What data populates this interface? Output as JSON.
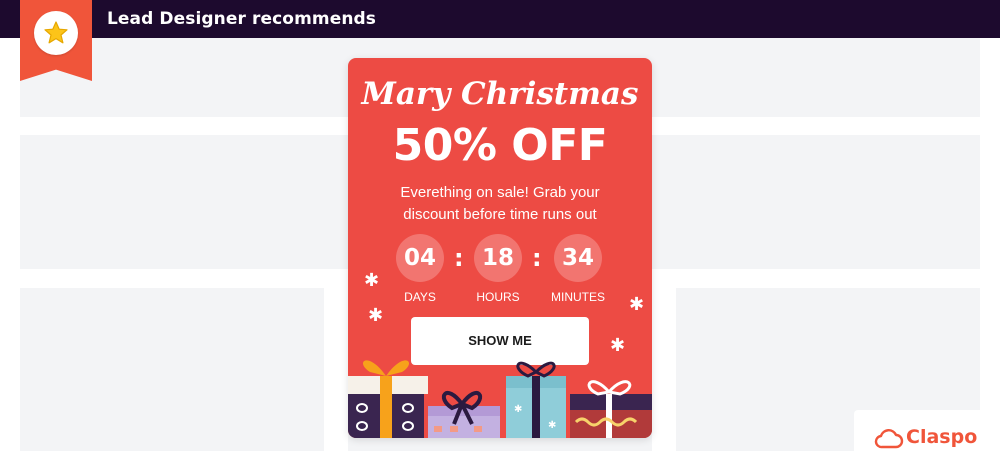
{
  "header": {
    "title": "Lead Designer recommends"
  },
  "badge": {
    "icon": "star-icon"
  },
  "popup": {
    "title": "Mary Christmas",
    "offer": "50% OFF",
    "description": "Everething on sale! Grab your discount before time runs out",
    "countdown": [
      {
        "value": "04",
        "label": "DAYS"
      },
      {
        "value": "18",
        "label": "HOURS"
      },
      {
        "value": "34",
        "label": "MINUTES"
      }
    ],
    "separator": ":",
    "cta_label": "SHOW ME",
    "decorations": [
      "snowflake-icon",
      "gift-boxes-illustration"
    ]
  },
  "brand": {
    "name": "Claspo",
    "icon": "cloud-logo-icon"
  },
  "colors": {
    "topbar": "#1d0a2e",
    "accent": "#f0553a",
    "popup_bg": "#ed4b44",
    "placeholder_block": "#f3f4f6"
  }
}
